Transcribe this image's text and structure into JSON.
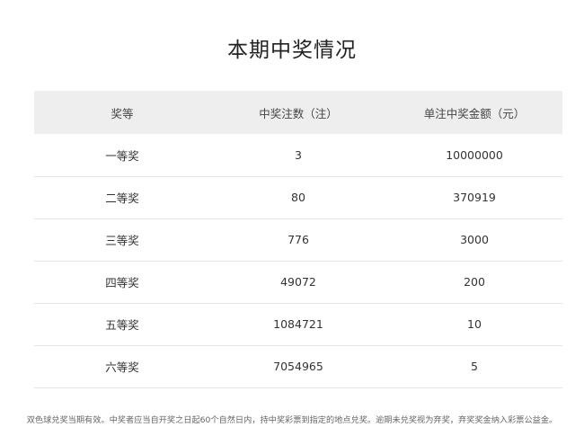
{
  "title": "本期中奖情况",
  "table": {
    "headers": [
      "奖等",
      "中奖注数（注）",
      "单注中奖金额（元）"
    ],
    "rows": [
      [
        "一等奖",
        "3",
        "10000000"
      ],
      [
        "二等奖",
        "80",
        "370919"
      ],
      [
        "三等奖",
        "776",
        "3000"
      ],
      [
        "四等奖",
        "49072",
        "200"
      ],
      [
        "五等奖",
        "1084721",
        "10"
      ],
      [
        "六等奖",
        "7054965",
        "5"
      ]
    ]
  },
  "footnote": "双色球兑奖当期有效。中奖者应当自开奖之日起60个自然日内，持中奖彩票到指定的地点兑奖。逾期未兑奖视为弃奖，弃奖奖金纳入彩票公益金。"
}
